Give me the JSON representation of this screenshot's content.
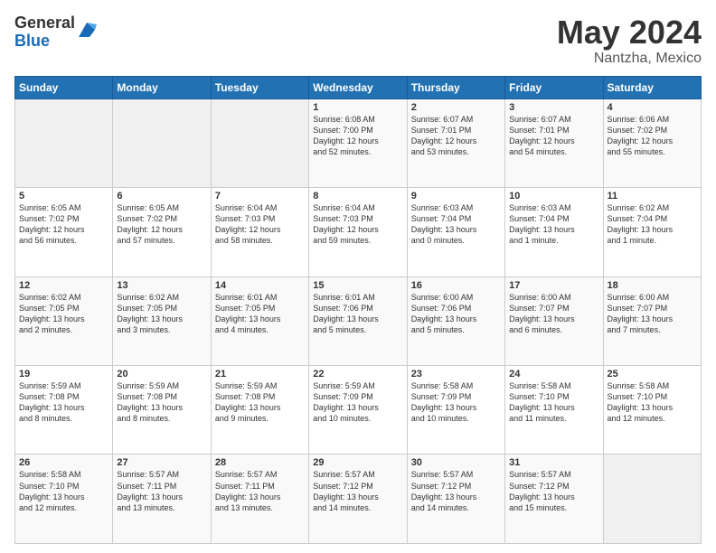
{
  "header": {
    "logo_general": "General",
    "logo_blue": "Blue",
    "month_title": "May 2024",
    "location": "Nantzha, Mexico"
  },
  "days_of_week": [
    "Sunday",
    "Monday",
    "Tuesday",
    "Wednesday",
    "Thursday",
    "Friday",
    "Saturday"
  ],
  "weeks": [
    [
      {
        "day": "",
        "info": ""
      },
      {
        "day": "",
        "info": ""
      },
      {
        "day": "",
        "info": ""
      },
      {
        "day": "1",
        "info": "Sunrise: 6:08 AM\nSunset: 7:00 PM\nDaylight: 12 hours\nand 52 minutes."
      },
      {
        "day": "2",
        "info": "Sunrise: 6:07 AM\nSunset: 7:01 PM\nDaylight: 12 hours\nand 53 minutes."
      },
      {
        "day": "3",
        "info": "Sunrise: 6:07 AM\nSunset: 7:01 PM\nDaylight: 12 hours\nand 54 minutes."
      },
      {
        "day": "4",
        "info": "Sunrise: 6:06 AM\nSunset: 7:02 PM\nDaylight: 12 hours\nand 55 minutes."
      }
    ],
    [
      {
        "day": "5",
        "info": "Sunrise: 6:05 AM\nSunset: 7:02 PM\nDaylight: 12 hours\nand 56 minutes."
      },
      {
        "day": "6",
        "info": "Sunrise: 6:05 AM\nSunset: 7:02 PM\nDaylight: 12 hours\nand 57 minutes."
      },
      {
        "day": "7",
        "info": "Sunrise: 6:04 AM\nSunset: 7:03 PM\nDaylight: 12 hours\nand 58 minutes."
      },
      {
        "day": "8",
        "info": "Sunrise: 6:04 AM\nSunset: 7:03 PM\nDaylight: 12 hours\nand 59 minutes."
      },
      {
        "day": "9",
        "info": "Sunrise: 6:03 AM\nSunset: 7:04 PM\nDaylight: 13 hours\nand 0 minutes."
      },
      {
        "day": "10",
        "info": "Sunrise: 6:03 AM\nSunset: 7:04 PM\nDaylight: 13 hours\nand 1 minute."
      },
      {
        "day": "11",
        "info": "Sunrise: 6:02 AM\nSunset: 7:04 PM\nDaylight: 13 hours\nand 1 minute."
      }
    ],
    [
      {
        "day": "12",
        "info": "Sunrise: 6:02 AM\nSunset: 7:05 PM\nDaylight: 13 hours\nand 2 minutes."
      },
      {
        "day": "13",
        "info": "Sunrise: 6:02 AM\nSunset: 7:05 PM\nDaylight: 13 hours\nand 3 minutes."
      },
      {
        "day": "14",
        "info": "Sunrise: 6:01 AM\nSunset: 7:05 PM\nDaylight: 13 hours\nand 4 minutes."
      },
      {
        "day": "15",
        "info": "Sunrise: 6:01 AM\nSunset: 7:06 PM\nDaylight: 13 hours\nand 5 minutes."
      },
      {
        "day": "16",
        "info": "Sunrise: 6:00 AM\nSunset: 7:06 PM\nDaylight: 13 hours\nand 5 minutes."
      },
      {
        "day": "17",
        "info": "Sunrise: 6:00 AM\nSunset: 7:07 PM\nDaylight: 13 hours\nand 6 minutes."
      },
      {
        "day": "18",
        "info": "Sunrise: 6:00 AM\nSunset: 7:07 PM\nDaylight: 13 hours\nand 7 minutes."
      }
    ],
    [
      {
        "day": "19",
        "info": "Sunrise: 5:59 AM\nSunset: 7:08 PM\nDaylight: 13 hours\nand 8 minutes."
      },
      {
        "day": "20",
        "info": "Sunrise: 5:59 AM\nSunset: 7:08 PM\nDaylight: 13 hours\nand 8 minutes."
      },
      {
        "day": "21",
        "info": "Sunrise: 5:59 AM\nSunset: 7:08 PM\nDaylight: 13 hours\nand 9 minutes."
      },
      {
        "day": "22",
        "info": "Sunrise: 5:59 AM\nSunset: 7:09 PM\nDaylight: 13 hours\nand 10 minutes."
      },
      {
        "day": "23",
        "info": "Sunrise: 5:58 AM\nSunset: 7:09 PM\nDaylight: 13 hours\nand 10 minutes."
      },
      {
        "day": "24",
        "info": "Sunrise: 5:58 AM\nSunset: 7:10 PM\nDaylight: 13 hours\nand 11 minutes."
      },
      {
        "day": "25",
        "info": "Sunrise: 5:58 AM\nSunset: 7:10 PM\nDaylight: 13 hours\nand 12 minutes."
      }
    ],
    [
      {
        "day": "26",
        "info": "Sunrise: 5:58 AM\nSunset: 7:10 PM\nDaylight: 13 hours\nand 12 minutes."
      },
      {
        "day": "27",
        "info": "Sunrise: 5:57 AM\nSunset: 7:11 PM\nDaylight: 13 hours\nand 13 minutes."
      },
      {
        "day": "28",
        "info": "Sunrise: 5:57 AM\nSunset: 7:11 PM\nDaylight: 13 hours\nand 13 minutes."
      },
      {
        "day": "29",
        "info": "Sunrise: 5:57 AM\nSunset: 7:12 PM\nDaylight: 13 hours\nand 14 minutes."
      },
      {
        "day": "30",
        "info": "Sunrise: 5:57 AM\nSunset: 7:12 PM\nDaylight: 13 hours\nand 14 minutes."
      },
      {
        "day": "31",
        "info": "Sunrise: 5:57 AM\nSunset: 7:12 PM\nDaylight: 13 hours\nand 15 minutes."
      },
      {
        "day": "",
        "info": ""
      }
    ]
  ]
}
